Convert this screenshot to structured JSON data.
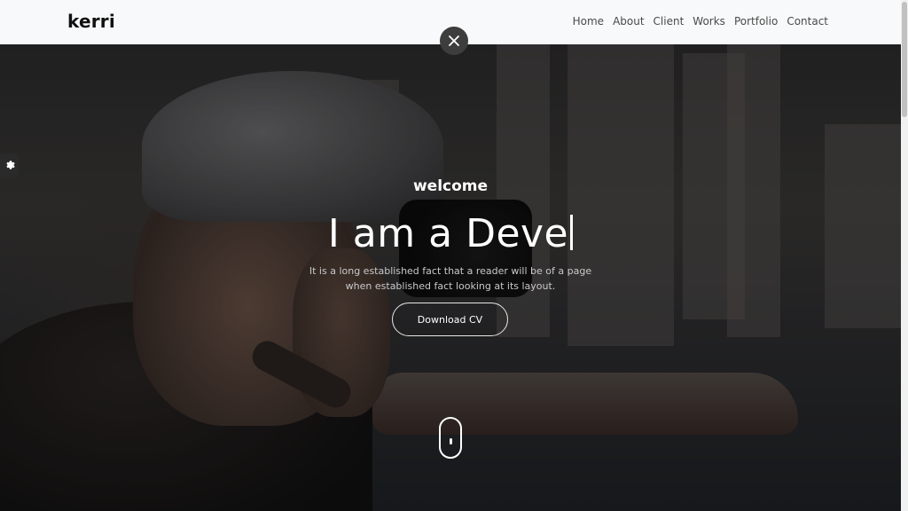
{
  "navbar": {
    "brand": "kerri",
    "links": [
      {
        "label": "Home"
      },
      {
        "label": "About"
      },
      {
        "label": "Client"
      },
      {
        "label": "Works"
      },
      {
        "label": "Portfolio"
      },
      {
        "label": "Contact"
      }
    ]
  },
  "icons": {
    "close": "close-icon",
    "settings": "gear-icon",
    "scroll": "mouse-scroll-icon"
  },
  "hero": {
    "welcome": "welcome",
    "headline": "I am a Deve",
    "description": "It is a long established fact that a reader will be of a page when established fact looking at its layout.",
    "cta_label": "Download CV"
  },
  "colors": {
    "navbar_bg": "#f8f9fa",
    "text_light": "#ffffff",
    "brand_text": "#111111"
  }
}
